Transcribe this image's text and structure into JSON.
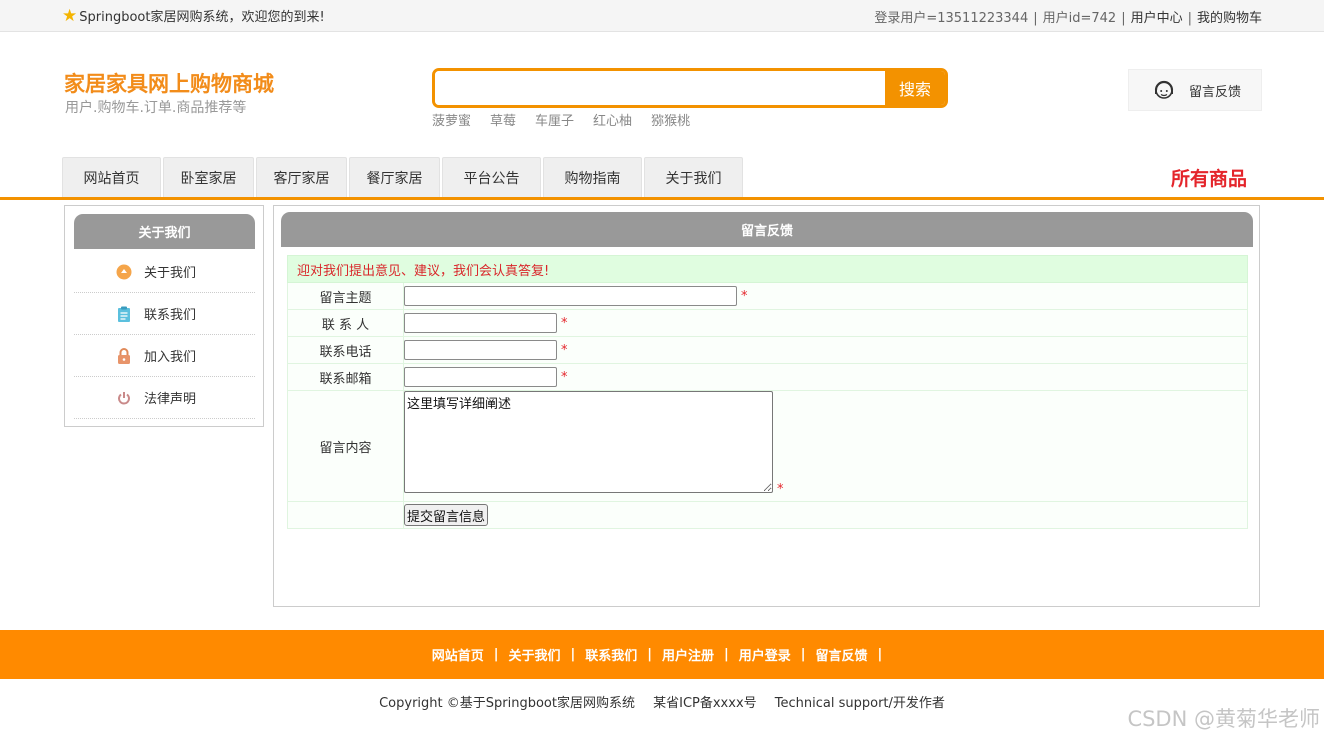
{
  "topbar": {
    "welcome": "Springboot家居网购系统，欢迎您的到来!",
    "login_user": "登录用户=13511223344",
    "user_id": "用户id=742",
    "user_center": "用户中心",
    "cart": "我的购物车",
    "separator": "|"
  },
  "logo": {
    "title": "家居家具网上购物商城",
    "subtitle": "用户.购物车.订单.商品推荐等"
  },
  "search": {
    "button": "搜索",
    "value": "",
    "hot": [
      "菠萝蜜",
      "草莓",
      "车厘子",
      "红心柚",
      "猕猴桃"
    ]
  },
  "feedback_entry": {
    "label": "留言反馈",
    "icon": "headset-user-icon"
  },
  "nav": {
    "tabs": [
      "网站首页",
      "卧室家居",
      "客厅家居",
      "餐厅家居",
      "平台公告",
      "购物指南",
      "关于我们"
    ],
    "all_goods": "所有商品"
  },
  "sidebar": {
    "title": "关于我们",
    "items": [
      {
        "label": "关于我们",
        "icon": "orange-circle-icon"
      },
      {
        "label": "联系我们",
        "icon": "clipboard-icon"
      },
      {
        "label": "加入我们",
        "icon": "lock-icon"
      },
      {
        "label": "法律声明",
        "icon": "power-icon"
      }
    ]
  },
  "main": {
    "title": "留言反馈",
    "notice": "迎对我们提出意见、建议，我们会认真答复!",
    "fields": {
      "subject": "留言主题",
      "contact": "联 系 人",
      "phone": "联系电话",
      "email": "联系邮箱",
      "content": "留言内容"
    },
    "content_placeholder": "这里填写详细阐述",
    "required_mark": "*",
    "submit": "提交留言信息"
  },
  "footer": {
    "links": [
      "网站首页",
      "关于我们",
      "联系我们",
      "用户注册",
      "用户登录",
      "留言反馈"
    ],
    "separator": "|",
    "copyright": "Copyright ©基于Springboot家居网购系统",
    "icp": "某省ICP备xxxx号",
    "support": "Technical support/开发作者"
  },
  "watermark": "CSDN @黄菊华老师",
  "colors": {
    "accent": "#f39200",
    "footer": "#ff8a00",
    "header_gray": "#999999",
    "notice_bg": "#e0fde0",
    "required": "#e4252b"
  }
}
